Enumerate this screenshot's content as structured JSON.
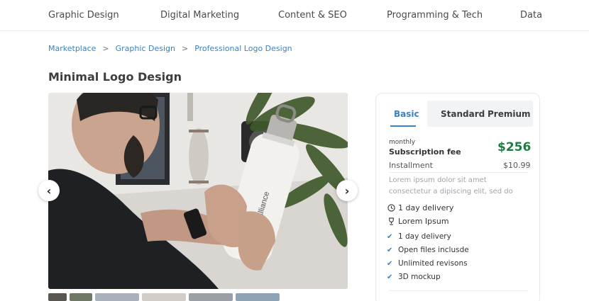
{
  "topnav": {
    "items": [
      "Graphic Design",
      "Digital Marketing",
      "Content & SEO",
      "Programming & Tech",
      "Data"
    ]
  },
  "breadcrumb": {
    "items": [
      "Marketplace",
      "Graphic Design",
      "Professional Logo Design"
    ],
    "separator": ">"
  },
  "page": {
    "title": "Minimal Logo Design"
  },
  "gallery": {
    "prev_icon": "‹",
    "next_icon": "›",
    "bottle_text": "Alliance"
  },
  "pricing": {
    "tabs": [
      "Basic",
      "Standard",
      "Premium"
    ],
    "active_tab": "Basic",
    "period": "monthly",
    "fee_label": "Subscription fee",
    "price": "$256",
    "installment_label": "Installment",
    "installment_value": "$10.99",
    "description": "Lorem ipsum dolor sit amet consectetur a dipiscing elit, sed do",
    "meta": [
      {
        "icon": "clock-icon",
        "label": "1 day delivery"
      },
      {
        "icon": "trophy-icon",
        "label": "Lorem Ipsum"
      }
    ],
    "features": [
      "1 day delivery",
      "Open files inclusde",
      "Unlimited revisons",
      "3D mockup"
    ],
    "colors": {
      "accent": "#3b82c4",
      "price": "#1e7c43"
    }
  }
}
